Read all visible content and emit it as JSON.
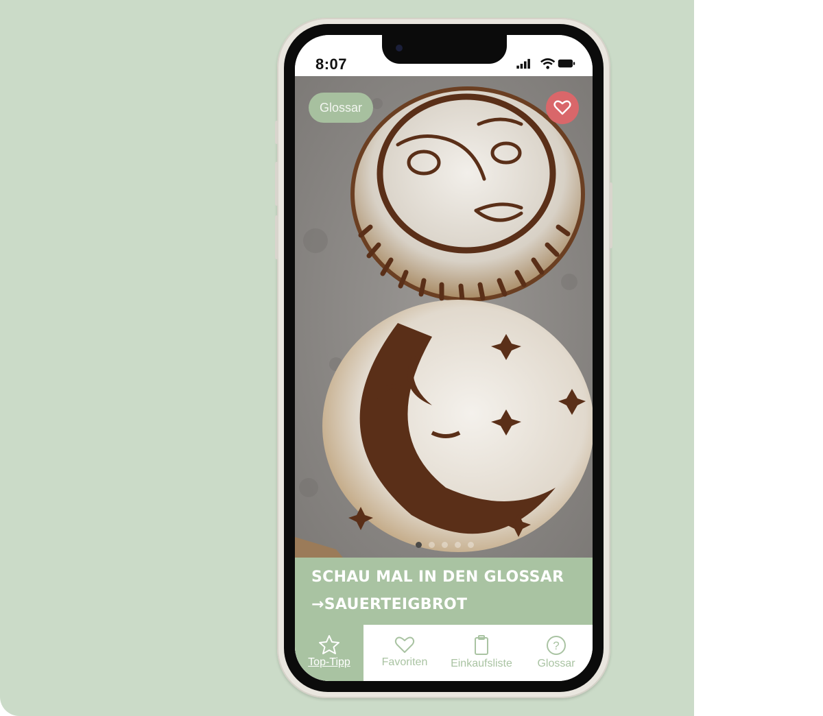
{
  "status_bar": {
    "time": "8:07"
  },
  "hero": {
    "chip_label": "Glossar",
    "carousel_pages": 5,
    "carousel_active_index": 0
  },
  "caption": {
    "line1": "SCHAU MAL IN DEN GLOSSAR",
    "line2": "→SAUERTEIGBROT"
  },
  "tabs": [
    {
      "label": "Top-Tipp",
      "icon": "star-icon",
      "active": true
    },
    {
      "label": "Favoriten",
      "icon": "heart-icon",
      "active": false
    },
    {
      "label": "Einkaufsliste",
      "icon": "list-icon",
      "active": false
    },
    {
      "label": "Glossar",
      "icon": "question-icon",
      "active": false
    }
  ],
  "colors": {
    "background": "#cbdbc8",
    "accent_green": "#a9c3a2",
    "favorite_red": "#d9676a"
  }
}
